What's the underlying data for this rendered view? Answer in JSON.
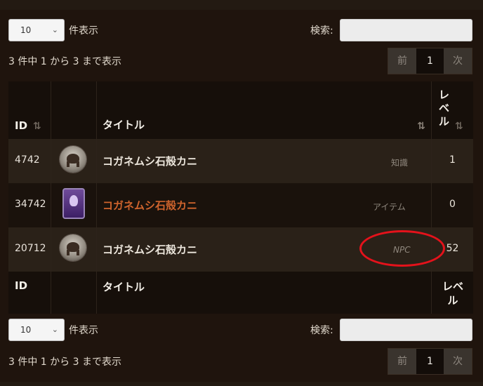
{
  "controls": {
    "length_value": "10",
    "length_label": "件表示",
    "search_label": "検索:",
    "search_value": ""
  },
  "info": "3 件中 1 から 3 まで表示",
  "pager": {
    "prev": "前",
    "current": "1",
    "next": "次"
  },
  "table": {
    "headers": {
      "id": "ID",
      "title": "タイトル",
      "level": "レベル"
    },
    "rows": [
      {
        "id": "4742",
        "title": "コガネムシ石殻カニ",
        "type": "知識",
        "level": "1",
        "icon": "crab-icon"
      },
      {
        "id": "34742",
        "title": "コガネムシ石殻カニ",
        "type": "アイテム",
        "level": "0",
        "icon": "purple-scroll-icon",
        "title_color": "#d0642d"
      },
      {
        "id": "20712",
        "title": "コガネムシ石殻カニ",
        "type": "NPC",
        "level": "52",
        "icon": "crab-icon"
      }
    ],
    "footer": {
      "id": "ID",
      "title": "タイトル",
      "level": "レベル"
    }
  },
  "annotation_color": "#e4121b"
}
